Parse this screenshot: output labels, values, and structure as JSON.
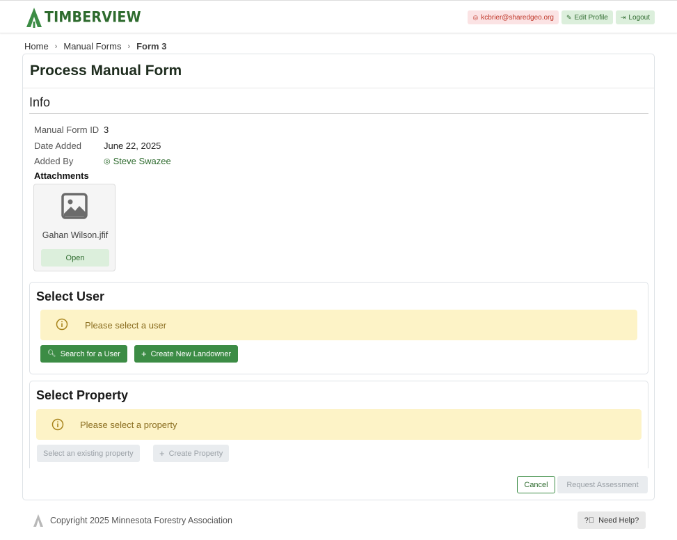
{
  "header": {
    "brand": "TIMBERVIEW",
    "email": "kcbrier@sharedgeo.org",
    "edit_profile": "Edit Profile",
    "logout": "Logout",
    "brand_color": "#2e6b2e"
  },
  "breadcrumb": {
    "home": "Home",
    "manual_forms": "Manual Forms",
    "current": "Form 3"
  },
  "page": {
    "title": "Process Manual Form"
  },
  "info": {
    "heading": "Info",
    "rows": [
      {
        "label": "Manual Form ID",
        "value": "3"
      },
      {
        "label": "Date Added",
        "value": "June 22, 2025"
      },
      {
        "label": "Added By",
        "value": "Steve Swazee"
      }
    ],
    "attachments_heading": "Attachments",
    "attachment": {
      "filename": "Gahan Wilson.jfif",
      "open_label": "Open",
      "icon": "image-icon"
    }
  },
  "select_user": {
    "title": "Select User",
    "alert": "Please select a user",
    "search_button": "Search for a User",
    "create_button": "Create New Landowner"
  },
  "select_property": {
    "title": "Select Property",
    "alert": "Please select a property",
    "existing_button": "Select an existing property",
    "create_button": "Create Property"
  },
  "actions": {
    "cancel": "Cancel",
    "request_assessment": "Request Assessment"
  },
  "footer": {
    "copyright": "Copyright 2025 Minnesota Forestry Association",
    "help": "Need Help?"
  },
  "colors": {
    "primary_green": "#3c8c45",
    "alert_bg": "#fdf3c7",
    "alert_text": "#8a6d1f"
  }
}
